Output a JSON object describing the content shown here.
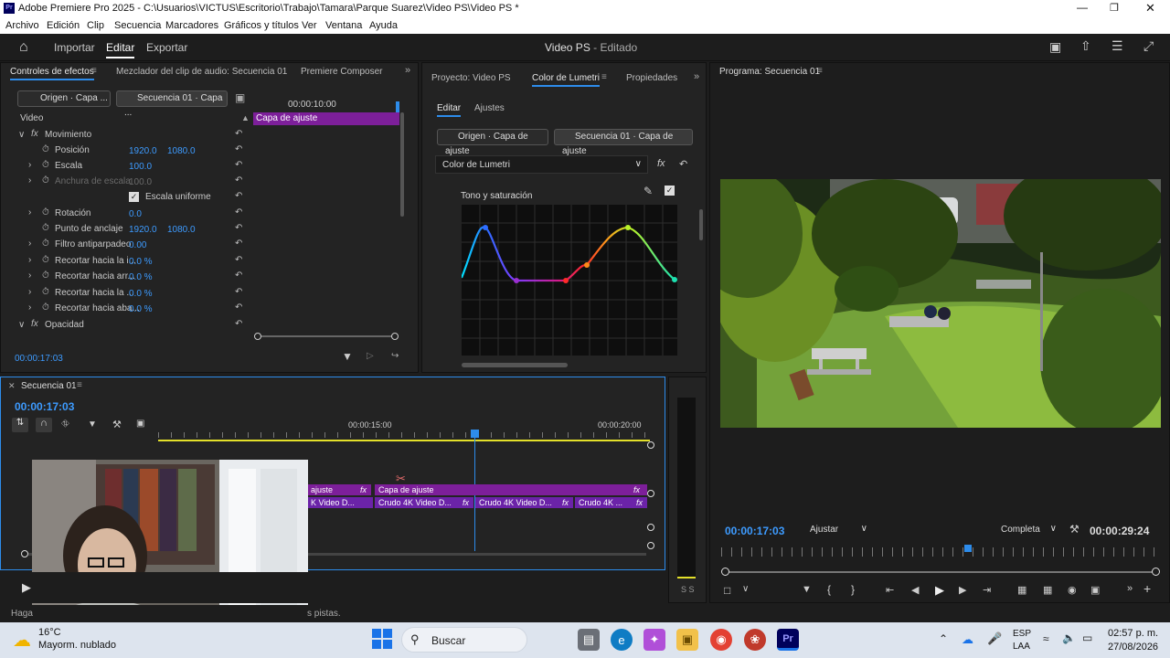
{
  "window": {
    "title": "Adobe Premiere Pro 2025 - C:\\Usuarios\\VICTUS\\Escritorio\\Trabajo\\Tamara\\Parque Suarez\\Video PS\\Video PS *",
    "app_icon": "Pr"
  },
  "menu": [
    "Archivo",
    "Edición",
    "Clip",
    "Secuencia",
    "Marcadores",
    "Gráficos y títulos",
    "Ver",
    "Ventana",
    "Ayuda"
  ],
  "topnav": {
    "importar": "Importar",
    "editar": "Editar",
    "exportar": "Exportar",
    "project": "Video PS",
    "state": "- Editado"
  },
  "effects": {
    "tabs": [
      "Controles de efectos",
      "Mezclador del clip de audio: Secuencia 01",
      "Premiere Composer"
    ],
    "source_btn": "Origen · Capa ...",
    "seq_btn": "Secuencia 01 · Capa ...",
    "timecode_ruler": "00:00:10:00",
    "clip_label": "Capa de ajuste",
    "video_label": "Video",
    "rows": [
      {
        "label": "Movimiento",
        "v1": "",
        "v2": ""
      },
      {
        "label": "Posición",
        "v1": "1920.0",
        "v2": "1080.0"
      },
      {
        "label": "Escala",
        "v1": "100.0",
        "v2": ""
      },
      {
        "label": "Anchura de escala",
        "v1": "100.0",
        "v2": ""
      },
      {
        "label": "Escala uniforme",
        "v1": "",
        "v2": ""
      },
      {
        "label": "Rotación",
        "v1": "0.0",
        "v2": ""
      },
      {
        "label": "Punto de anclaje",
        "v1": "1920.0",
        "v2": "1080.0"
      },
      {
        "label": "Filtro antiparpadeo",
        "v1": "0.00",
        "v2": ""
      },
      {
        "label": "Recortar hacia la i...",
        "v1": "0.0 %",
        "v2": ""
      },
      {
        "label": "Recortar hacia arr...",
        "v1": "0.0 %",
        "v2": ""
      },
      {
        "label": "Recortar hacia la ...",
        "v1": "0.0 %",
        "v2": ""
      },
      {
        "label": "Recortar hacia aba...",
        "v1": "0.0 %",
        "v2": ""
      },
      {
        "label": "Opacidad",
        "v1": "",
        "v2": ""
      }
    ],
    "timecode": "00:00:17:03"
  },
  "lumetri": {
    "tabs": [
      "Proyecto: Video PS",
      "Color de Lumetri",
      "Propiedades"
    ],
    "subtabs": [
      "Editar",
      "Ajustes"
    ],
    "source_btn": "Origen · Capa de ajuste",
    "seq_btn": "Secuencia 01 · Capa de ajuste",
    "effect_select": "Color de Lumetri",
    "section": "Tono y saturación"
  },
  "program": {
    "title": "Programa: Secuencia 01",
    "timecode": "00:00:17:03",
    "fit": "Ajustar",
    "quality": "Completa",
    "duration": "00:00:29:24"
  },
  "timeline": {
    "title": "Secuencia 01",
    "timecode": "00:00:17:03",
    "ruler": [
      "00:00:15:00",
      "00:00:20:00"
    ],
    "clips_top": [
      "ajuste",
      "Capa de ajuste"
    ],
    "clips_bottom": [
      "K Video D...",
      "Crudo 4K Video D...",
      "Crudo 4K Video D...",
      "Crudo 4K ..."
    ],
    "fx": "fx"
  },
  "status": {
    "left": "Haga",
    "right": "s pistas."
  },
  "meter_labels": "S S",
  "taskbar": {
    "weather_temp": "16°C",
    "weather_desc": "Mayorm. nublado",
    "search": "Buscar",
    "lang1": "ESP",
    "lang2": "LAA",
    "time": "02:57 p. m.",
    "date": "27/08/2026"
  },
  "colors": {
    "accent": "#2d8ceb",
    "clip_purple": "#7d1f9a",
    "playhead": "#2d8ceb",
    "timecode_blue": "#3d9bff"
  }
}
